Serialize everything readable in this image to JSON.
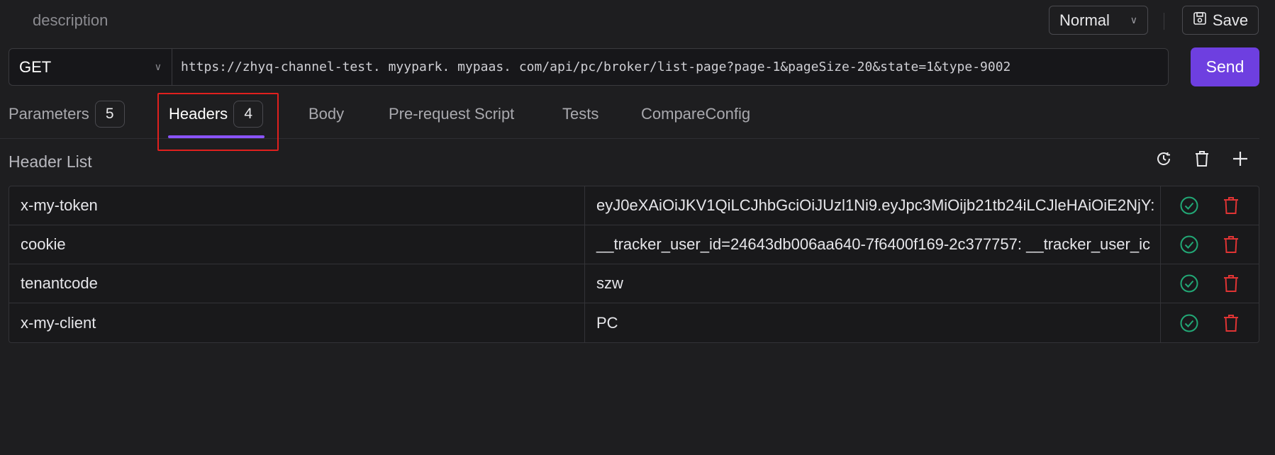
{
  "top": {
    "description_placeholder": "description",
    "mode_select_value": "Normal",
    "save_label": "Save"
  },
  "request": {
    "method": "GET",
    "url": "https://zhyq-channel-test. myypark. mypaas. com/api/pc/broker/list-page?page-1&pageSize-20&state=1&type-9002",
    "send_label": "Send"
  },
  "tabs": [
    {
      "label": "Parameters",
      "count": "5"
    },
    {
      "label": "Headers",
      "count": "4"
    },
    {
      "label": "Body"
    },
    {
      "label": "Pre-request Script"
    },
    {
      "label": "Tests"
    },
    {
      "label": "CompareConfig"
    }
  ],
  "active_tab": "Headers",
  "header_list": {
    "title": "Header List",
    "rows": [
      {
        "key": "x-my-token",
        "value": "eyJ0eXAiOiJKV1QiLCJhbGciOiJUzl1Ni9.eyJpc3MiOijb21tb24iLCJleHAiOiE2NjY:"
      },
      {
        "key": "cookie",
        "value": "__tracker_user_id=24643db006aa640-7f6400f169-2c377757: __tracker_user_ic"
      },
      {
        "key": "tenantcode",
        "value": "szw"
      },
      {
        "key": "x-my-client",
        "value": "PC"
      }
    ]
  },
  "colors": {
    "background": "#1e1e20",
    "accent": "#6e3fe0",
    "tab_underline": "#8a54ff",
    "enabled_icon": "#22a876",
    "delete_icon": "#e03434",
    "highlight_box": "#e0201e"
  }
}
